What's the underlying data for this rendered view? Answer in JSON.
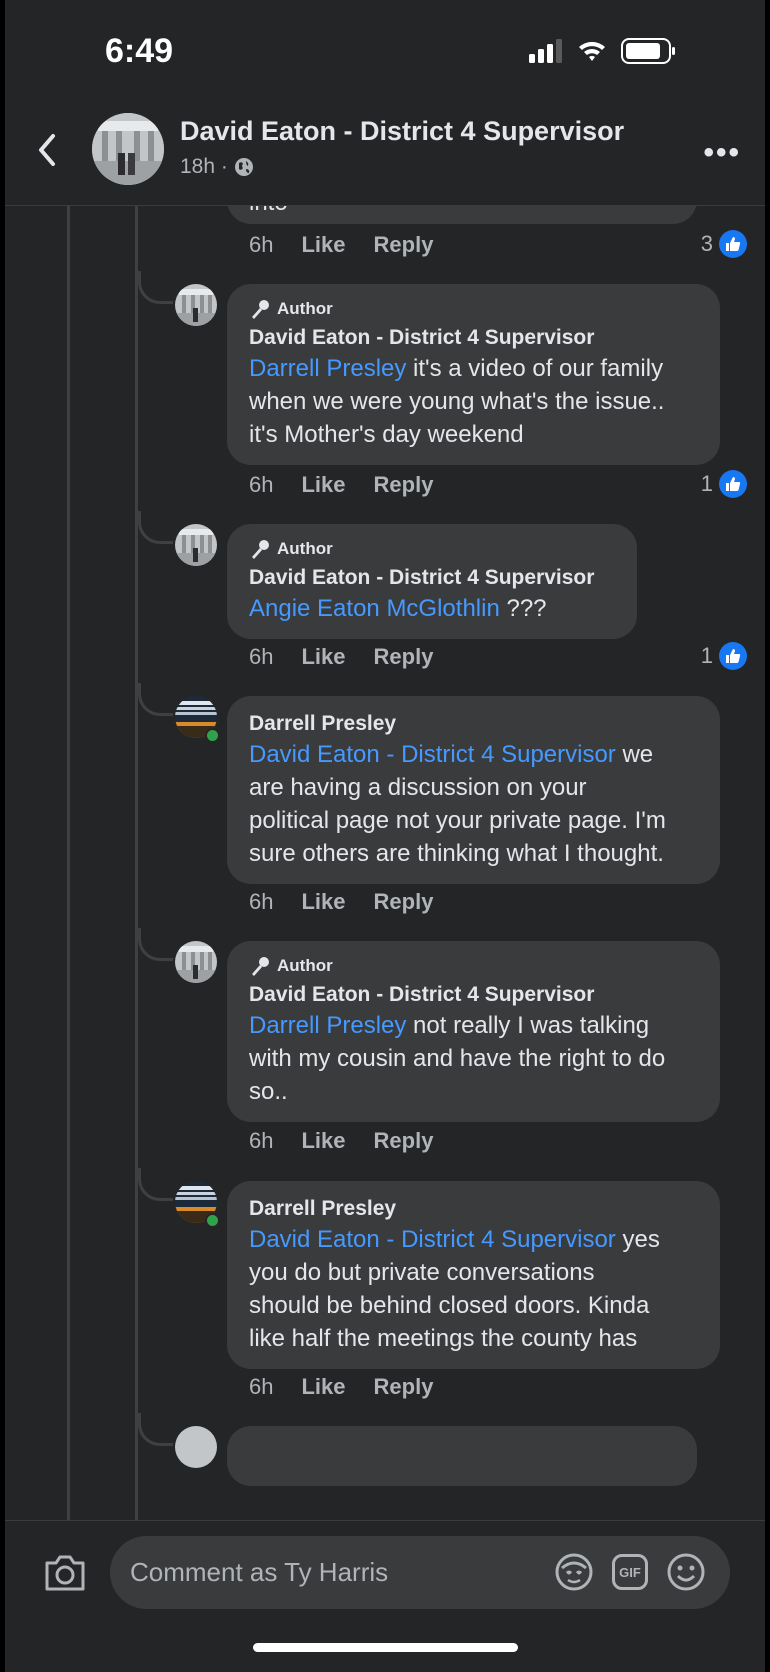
{
  "status_bar": {
    "time": "6:49"
  },
  "header": {
    "title": "David Eaton - District 4 Supervisor",
    "time_ago": "18h ·"
  },
  "previous_comment": {
    "tail_text": "into",
    "time": "6h",
    "like": "Like",
    "reply": "Reply",
    "reaction_count": "3"
  },
  "comments": [
    {
      "badge": "Author",
      "author": "David Eaton - District 4 Supervisor",
      "mention": "Darrell Presley",
      "text_line1": " it's a video of our family",
      "text_rest": [
        "when we were young what's the issue..",
        "it's Mother's day weekend"
      ],
      "time": "6h",
      "like": "Like",
      "reply": "Reply",
      "reaction_count": "1"
    },
    {
      "badge": "Author",
      "author": "David Eaton - District 4 Supervisor",
      "mention": "Angie Eaton McGlothlin",
      "text_line1": " ???",
      "text_rest": [],
      "time": "6h",
      "like": "Like",
      "reply": "Reply",
      "reaction_count": "1"
    },
    {
      "badge": "",
      "author": "Darrell Presley",
      "mention": "David Eaton - District 4 Supervisor",
      "text_line1": " we",
      "text_rest": [
        "are having a discussion on your",
        "political page not your private page. I'm",
        "sure others are thinking what I thought."
      ],
      "time": "6h",
      "like": "Like",
      "reply": "Reply",
      "reaction_count": ""
    },
    {
      "badge": "Author",
      "author": "David Eaton - District 4 Supervisor",
      "mention": "Darrell Presley",
      "text_line1": " not really I was talking",
      "text_rest": [
        "with my cousin and have the right to do",
        "so.."
      ],
      "time": "6h",
      "like": "Like",
      "reply": "Reply",
      "reaction_count": ""
    },
    {
      "badge": "",
      "author": "Darrell Presley",
      "mention": "David Eaton - District 4 Supervisor",
      "text_line1": " yes",
      "text_rest": [
        "you do but private conversations",
        "should be behind closed doors. Kinda",
        "like half the meetings the county has"
      ],
      "time": "6h",
      "like": "Like",
      "reply": "Reply",
      "reaction_count": ""
    }
  ],
  "composer": {
    "placeholder": "Comment as Ty Harris",
    "gif_label": "GIF"
  },
  "colors": {
    "background": "#242526",
    "bubble": "#3a3b3c",
    "mention": "#4599ff",
    "like_badge": "#1877f2"
  }
}
